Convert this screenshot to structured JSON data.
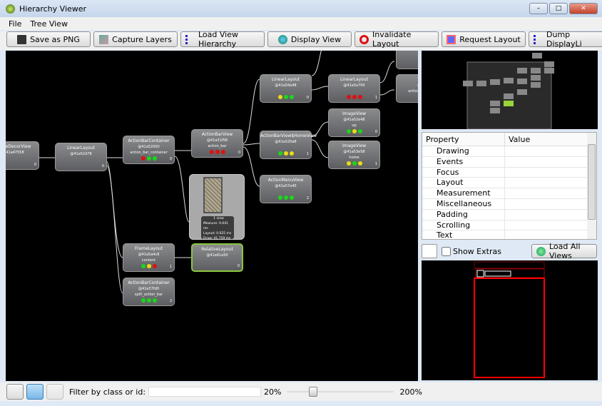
{
  "window": {
    "title": "Hierarchy Viewer",
    "controls": [
      "minimize",
      "maximize",
      "close"
    ]
  },
  "menu": [
    "File",
    "Tree View"
  ],
  "toolbar": [
    {
      "label": "Save as PNG",
      "icon": "floppy-icon"
    },
    {
      "label": "Capture Layers",
      "icon": "layers-icon"
    },
    {
      "label": "Load View Hierarchy",
      "icon": "hierarchy-icon"
    },
    {
      "label": "Display View",
      "icon": "globe-icon"
    },
    {
      "label": "Invalidate Layout",
      "icon": "no-entry-icon"
    },
    {
      "label": "Request Layout",
      "icon": "request-layout-icon"
    },
    {
      "label": "Dump DisplayLi",
      "icon": "hierarchy-icon"
    }
  ],
  "colors": {
    "red": "#e01010",
    "green": "#19d81b",
    "yellow": "#e8dd14",
    "selected": "#8cc63f"
  },
  "nodes": [
    {
      "name": "...dowDecorView",
      "addr": "@41a47558",
      "id": "",
      "index": "0",
      "lights": []
    },
    {
      "name": "LinearLayout",
      "addr": "@41a52d78",
      "id": "",
      "index": "0",
      "lights": []
    },
    {
      "name": "ActionBarContainer",
      "addr": "@41a52000",
      "id": "action_bar_container",
      "index": "0",
      "lights": [
        "red",
        "green",
        "green"
      ]
    },
    {
      "name": "ActionBarView",
      "addr": "@41a51f58",
      "id": "action_bar",
      "index": "0",
      "lights": [
        "red",
        "red",
        "red"
      ]
    },
    {
      "name": "LinearLayout",
      "addr": "@41a54a48",
      "id": "",
      "index": "0",
      "lights": [
        "yellow",
        "green",
        "green"
      ]
    },
    {
      "name": "ActionBarView$HomeView",
      "addr": "@41a520a8",
      "id": "",
      "index": "1",
      "lights": [
        "green",
        "yellow",
        "yellow"
      ]
    },
    {
      "name": "ActionMenuView",
      "addr": "@41a57a40",
      "id": "",
      "index": "2",
      "lights": [
        "green",
        "green",
        "green"
      ]
    },
    {
      "name": "LinearLayout",
      "addr": "@41a5a700",
      "id": "",
      "index": "1",
      "lights": [
        "red",
        "red",
        "red"
      ]
    },
    {
      "name": "ImageView",
      "addr": "@41a52e48",
      "id": "up",
      "index": "0",
      "lights": [
        "green",
        "yellow",
        "green"
      ]
    },
    {
      "name": "ImageView",
      "addr": "@41a53e58",
      "id": "home",
      "index": "1",
      "lights": [
        "yellow",
        "green",
        "yellow"
      ]
    },
    {
      "name": "FrameLayout",
      "addr": "@41a5a4c8",
      "id": "content",
      "index": "1",
      "lights": [
        "green",
        "yellow",
        "red"
      ]
    },
    {
      "name": "RelativeLayout",
      "addr": "@41a61a50",
      "id": "",
      "index": "0",
      "lights": []
    },
    {
      "name": "ActionBarContainer",
      "addr": "@41a57fd0",
      "id": "split_action_bar",
      "index": "2",
      "lights": [
        "green",
        "green",
        "green"
      ]
    },
    {
      "name": "Te...",
      "addr": "@4...",
      "id": "action_bar_title",
      "index": "1",
      "lights": [
        "green"
      ]
    },
    {
      "name": "",
      "addr": "",
      "id": "",
      "index": "0",
      "lights": [
        "red"
      ]
    }
  ],
  "tooltip": {
    "lines": [
      "1 view",
      "Measure: 0.041 ms",
      "Layout: 0.025 ms",
      "Draw: 41.759 ms"
    ]
  },
  "properties": {
    "headers": [
      "Property",
      "Value"
    ],
    "rows": [
      "Drawing",
      "Events",
      "Focus",
      "Layout",
      "Measurement",
      "Miscellaneous",
      "Padding",
      "Scrolling",
      "Text"
    ]
  },
  "extras": {
    "show_extras": "Show Extras",
    "load_all": "Load All Views",
    "checked": false
  },
  "status": {
    "filter_label": "Filter by class or id:",
    "filter_value": "",
    "zoom_min": "20%",
    "zoom_max": "200%",
    "zoom_fraction": 0.22
  }
}
